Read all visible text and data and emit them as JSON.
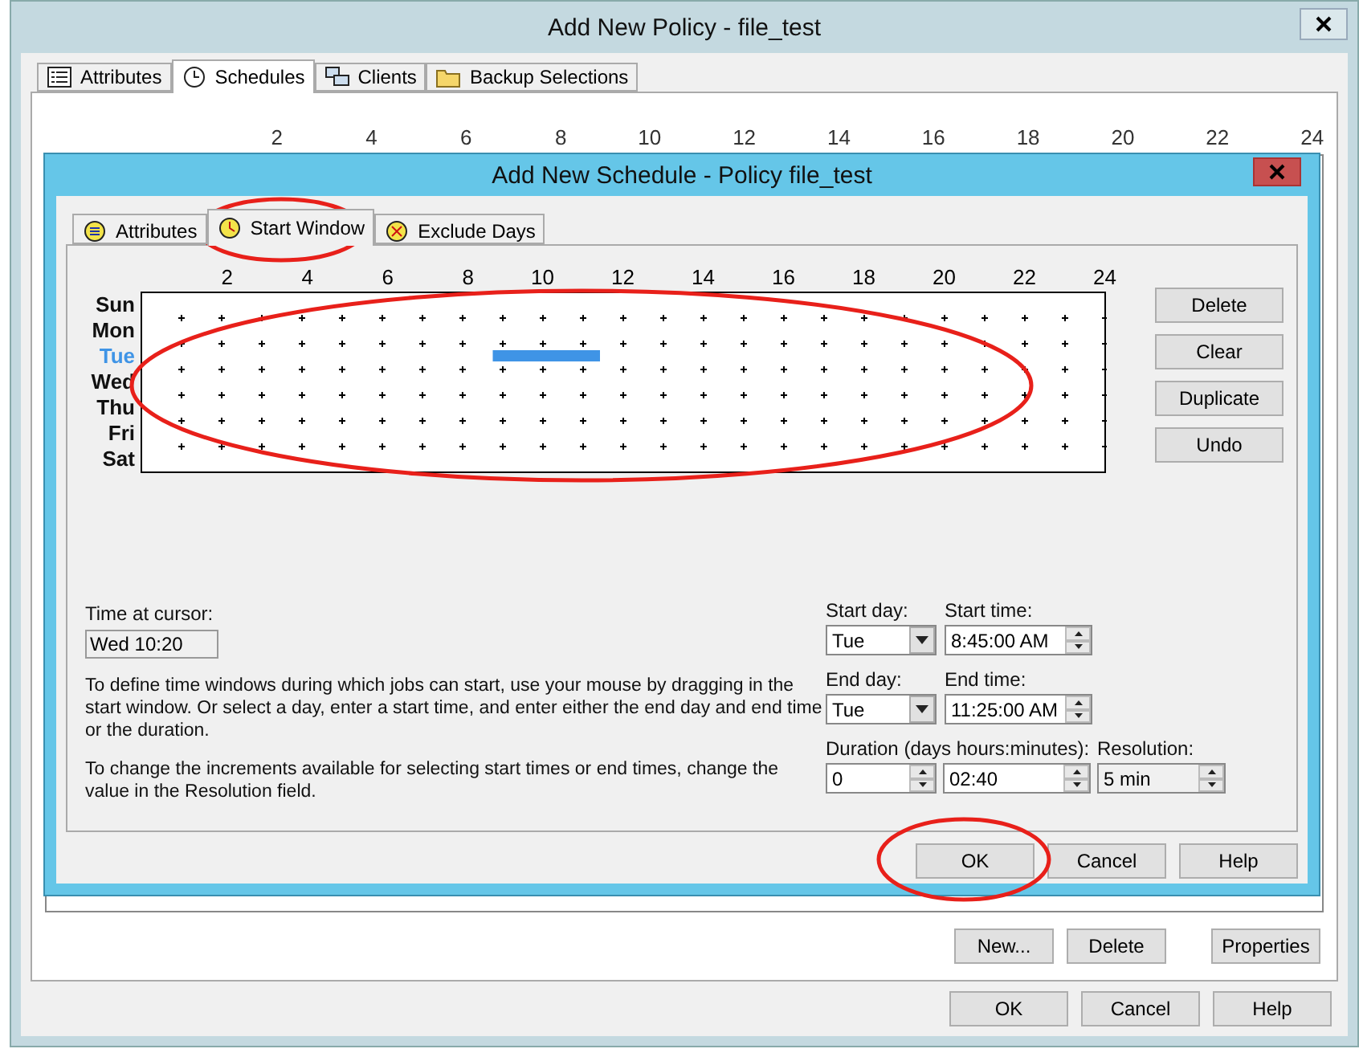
{
  "window": {
    "title": "Add New Policy - file_test"
  },
  "tabs": [
    {
      "label": "Attributes",
      "selected": false,
      "kind": "list"
    },
    {
      "label": "Schedules",
      "selected": true,
      "kind": "clock"
    },
    {
      "label": "Clients",
      "selected": false,
      "kind": "computers"
    },
    {
      "label": "Backup Selections",
      "selected": false,
      "kind": "folder"
    }
  ],
  "background_hours": [
    "2",
    "4",
    "6",
    "8",
    "10",
    "12",
    "14",
    "16",
    "18",
    "20",
    "22",
    "24"
  ],
  "policy_buttons": [
    "New...",
    "Delete",
    "Properties"
  ],
  "buttons": [
    "OK",
    "Cancel",
    "Help"
  ],
  "dialog": {
    "title": "Add New Schedule - Policy file_test",
    "tabs": [
      {
        "label": "Attributes",
        "selected": false,
        "kind": "attributes"
      },
      {
        "label": "Start Window",
        "selected": true,
        "kind": "window"
      },
      {
        "label": "Exclude Days",
        "selected": false,
        "kind": "exclude"
      }
    ],
    "hours": [
      "2",
      "4",
      "6",
      "8",
      "10",
      "12",
      "14",
      "16",
      "18",
      "20",
      "22",
      "24"
    ],
    "days": [
      {
        "label": "Sun",
        "selected": false
      },
      {
        "label": "Mon",
        "selected": false
      },
      {
        "label": "Tue",
        "selected": true
      },
      {
        "label": "Wed",
        "selected": false
      },
      {
        "label": "Thu",
        "selected": false
      },
      {
        "label": "Fri",
        "selected": false
      },
      {
        "label": "Sat",
        "selected": false
      }
    ],
    "side_buttons": [
      "Delete",
      "Clear",
      "Duplicate",
      "Undo"
    ],
    "time_at_cursor": {
      "label": "Time at cursor:",
      "value": "Wed 10:20"
    },
    "help_texts": [
      "To define time windows during which jobs can start, use your mouse by dragging in the start window.  Or select a day, enter a start time, and enter either the end day and end time or the duration.",
      "To change the increments available for selecting start times or end times, change the value in the Resolution field."
    ],
    "start_day": {
      "label": "Start day:",
      "value": "Tue"
    },
    "start_time": {
      "label": "Start time:",
      "value": "8:45:00 AM"
    },
    "end_day": {
      "label": "End day:",
      "value": "Tue"
    },
    "end_time": {
      "label": "End time:",
      "value": "11:25:00 AM"
    },
    "duration": {
      "label": "Duration (days hours:minutes):",
      "days": "0",
      "time": "02:40"
    },
    "resolution": {
      "label": "Resolution:",
      "value": "5 min"
    },
    "buttons": [
      "OK",
      "Cancel",
      "Help"
    ]
  }
}
